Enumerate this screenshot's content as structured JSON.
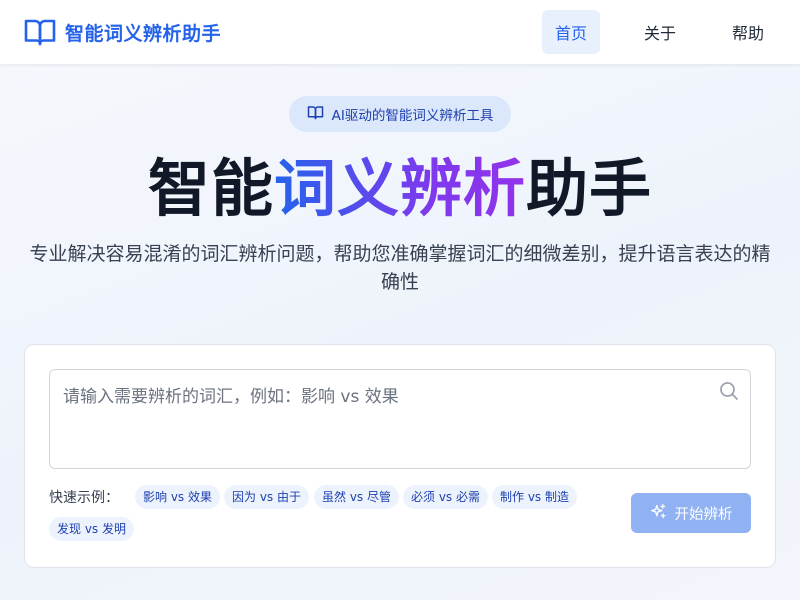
{
  "brand": {
    "name": "智能词义辨析助手",
    "icon": "book-open-icon"
  },
  "nav": {
    "items": [
      {
        "label": "首页",
        "active": true
      },
      {
        "label": "关于",
        "active": false
      },
      {
        "label": "帮助",
        "active": false
      }
    ]
  },
  "hero": {
    "badge": "AI驱动的智能词义辨析工具",
    "title_prefix": "智能",
    "title_highlight": "词义辨析",
    "title_suffix": "助手",
    "subtitle": "专业解决容易混淆的词汇辨析问题，帮助您准确掌握词汇的细微差别，提升语言表达的精确性"
  },
  "search": {
    "placeholder": "请输入需要辨析的词汇，例如：影响 vs 效果",
    "value": "",
    "icon": "search-icon"
  },
  "quick": {
    "label": "快速示例：",
    "examples": [
      "影响 vs 效果",
      "因为 vs 由于",
      "虽然 vs 尽管",
      "必须 vs 必需",
      "制作 vs 制造",
      "发现 vs 发明"
    ]
  },
  "action": {
    "start_label": "开始辨析",
    "icon": "sparkles-icon"
  },
  "colors": {
    "accent": "#2563eb",
    "gradient_end": "#9333ea",
    "button_disabled": "#90b1f2"
  }
}
